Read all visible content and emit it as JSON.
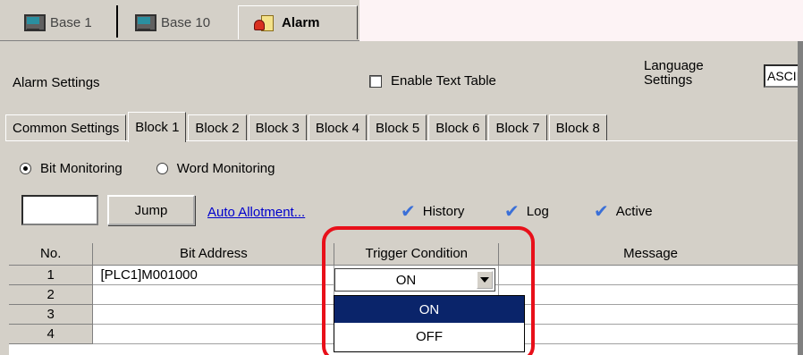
{
  "doc_tabs": [
    {
      "label": "Base 1",
      "icon": "monitor-icon"
    },
    {
      "label": "Base 10",
      "icon": "monitor-icon"
    },
    {
      "label": "Alarm",
      "icon": "alarm-icon",
      "active": true
    }
  ],
  "settings": {
    "title": "Alarm Settings",
    "enable_text_table": "Enable Text Table",
    "enable_text_table_checked": false,
    "language_label_line1": "Language",
    "language_label_line2": "Settings",
    "language_value": "ASCII"
  },
  "block_tabs": [
    "Common Settings",
    "Block 1",
    "Block 2",
    "Block 3",
    "Block 4",
    "Block 5",
    "Block 6",
    "Block 7",
    "Block 8"
  ],
  "active_block_tab": "Block 1",
  "monitoring": {
    "bit": "Bit Monitoring",
    "word": "Word Monitoring",
    "selected": "Bit Monitoring"
  },
  "toolbar": {
    "jump_value": "",
    "jump_label": "Jump",
    "auto_allotment": "Auto Allotment...",
    "history": "History",
    "log": "Log",
    "active": "Active"
  },
  "table": {
    "headers": [
      "No.",
      "Bit Address",
      "Trigger Condition",
      "Message"
    ],
    "rows": [
      {
        "no": "1",
        "address": "[PLC1]M001000",
        "trigger": "ON"
      },
      {
        "no": "2",
        "address": "",
        "trigger": ""
      },
      {
        "no": "3",
        "address": "",
        "trigger": ""
      },
      {
        "no": "4",
        "address": "",
        "trigger": ""
      }
    ]
  },
  "trigger_dropdown": {
    "current": "ON",
    "options": [
      "ON",
      "OFF"
    ],
    "highlighted": "ON"
  },
  "colors": {
    "highlight_ring": "#e8101a",
    "link": "#0000cc",
    "check": "#3a6fd8",
    "selection": "#0a246a"
  }
}
